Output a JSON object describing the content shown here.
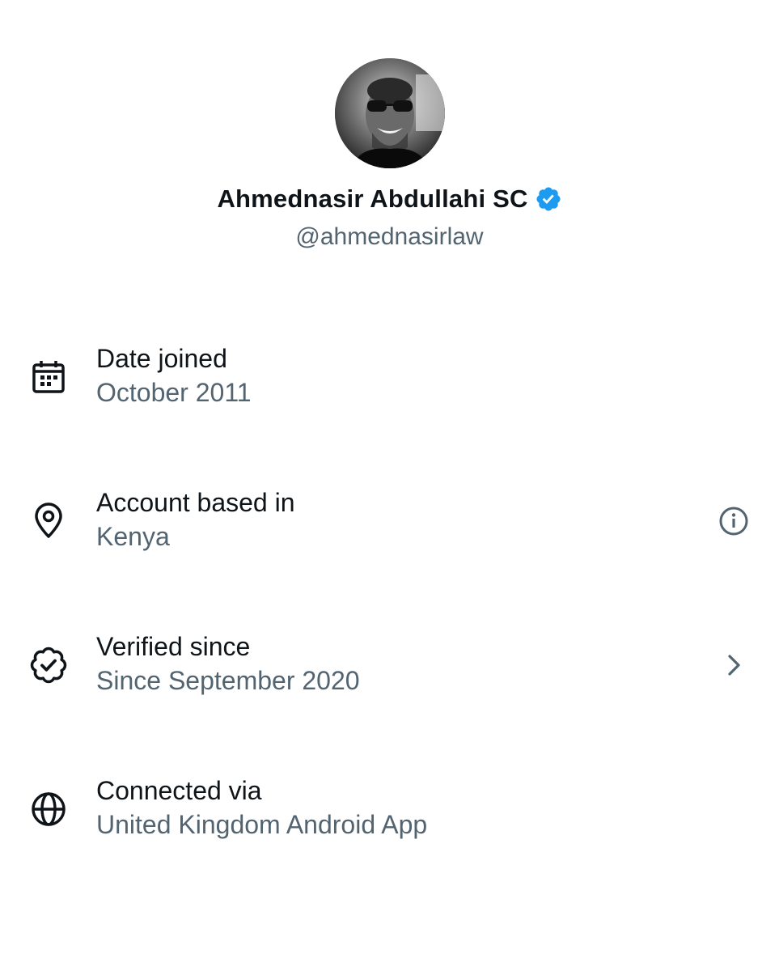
{
  "profile": {
    "display_name": "Ahmednasir Abdullahi SC",
    "handle": "@ahmednasirlaw",
    "verified": true
  },
  "info_rows": [
    {
      "icon": "calendar-icon",
      "label": "Date joined",
      "value": "October 2011",
      "action": "none"
    },
    {
      "icon": "location-pin-icon",
      "label": "Account based in",
      "value": "Kenya",
      "action": "info-icon"
    },
    {
      "icon": "verified-check-icon",
      "label": "Verified since",
      "value": "Since September 2020",
      "action": "chevron-right-icon"
    },
    {
      "icon": "globe-icon",
      "label": "Connected via",
      "value": "United Kingdom Android App",
      "action": "none"
    }
  ],
  "colors": {
    "text_primary": "#0f1419",
    "text_secondary": "#536471",
    "verified_blue": "#1d9bf0",
    "background": "#ffffff"
  }
}
